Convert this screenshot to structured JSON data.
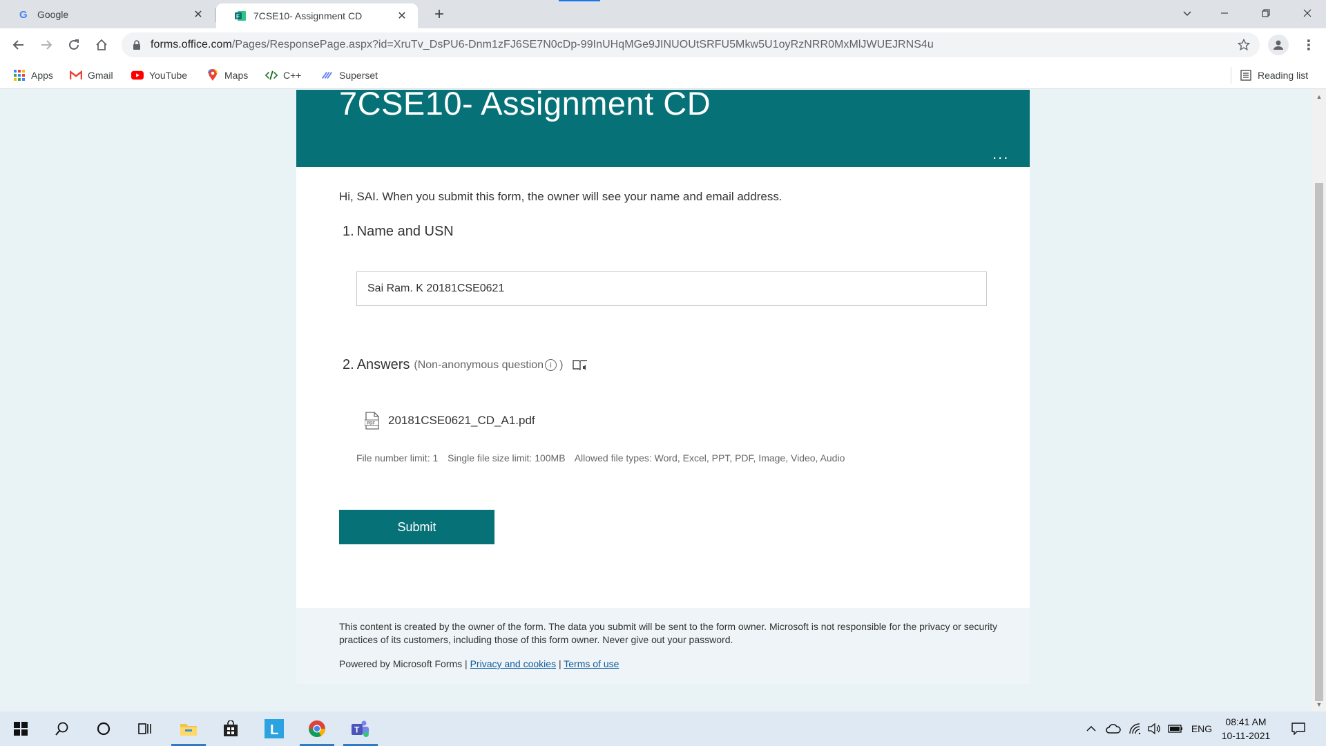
{
  "browser": {
    "tabs": [
      {
        "title": "Google",
        "icon": "google-icon"
      },
      {
        "title": "7CSE10- Assignment CD",
        "icon": "forms-icon",
        "active": true
      }
    ],
    "new_tab": "+",
    "url_host": "forms.office.com",
    "url_path": "/Pages/ResponsePage.aspx?id=XruTv_DsPU6-Dnm1zFJ6SE7N0cDp-99InUHqMGe9JINUOUtSRFU5Mkw5U1oyRzNRR0MxMlJWUEJRNS4u",
    "bookmarks": [
      {
        "label": "Apps",
        "icon": "apps-grid-icon"
      },
      {
        "label": "Gmail",
        "icon": "gmail-icon"
      },
      {
        "label": "YouTube",
        "icon": "youtube-icon"
      },
      {
        "label": "Maps",
        "icon": "maps-icon"
      },
      {
        "label": "C++",
        "icon": "code-icon"
      },
      {
        "label": "Superset",
        "icon": "superset-icon"
      }
    ],
    "reading_list": "Reading list"
  },
  "form": {
    "title": "7CSE10- Assignment CD",
    "more": "...",
    "intro": "Hi, SAI. When you submit this form, the owner will see your name and email address.",
    "questions": [
      {
        "number": "1.",
        "title": "Name and USN",
        "answer": "Sai Ram. K 20181CSE0621"
      },
      {
        "number": "2.",
        "title": "Answers",
        "note_open": "(Non-anonymous question",
        "note_close": ")",
        "info": "i",
        "file": "20181CSE0621_CD_A1.pdf",
        "limits": {
          "count": "File number limit: 1",
          "size": "Single file size limit: 100MB",
          "types": "Allowed file types: Word, Excel, PPT, PDF, Image, Video, Audio"
        }
      }
    ],
    "submit_label": "Submit"
  },
  "footer": {
    "disclaimer": "This content is created by the owner of the form. The data you submit will be sent to the form owner. Microsoft is not responsible for the privacy or security practices of its customers, including those of this form owner. Never give out your password.",
    "powered_by": "Powered by Microsoft Forms | ",
    "privacy_link": "Privacy and cookies",
    "sep": " | ",
    "terms_link": "Terms of use"
  },
  "taskbar": {
    "apps": [
      "start-icon",
      "search-icon",
      "cortana-icon",
      "task-view-icon",
      "file-explorer-icon",
      "store-icon",
      "l-app-icon",
      "chrome-icon",
      "teams-icon"
    ],
    "language": "ENG",
    "time": "08:41 AM",
    "date": "10-11-2021"
  },
  "colors": {
    "accent": "#077178",
    "page_bg": "#e9f2f5"
  }
}
